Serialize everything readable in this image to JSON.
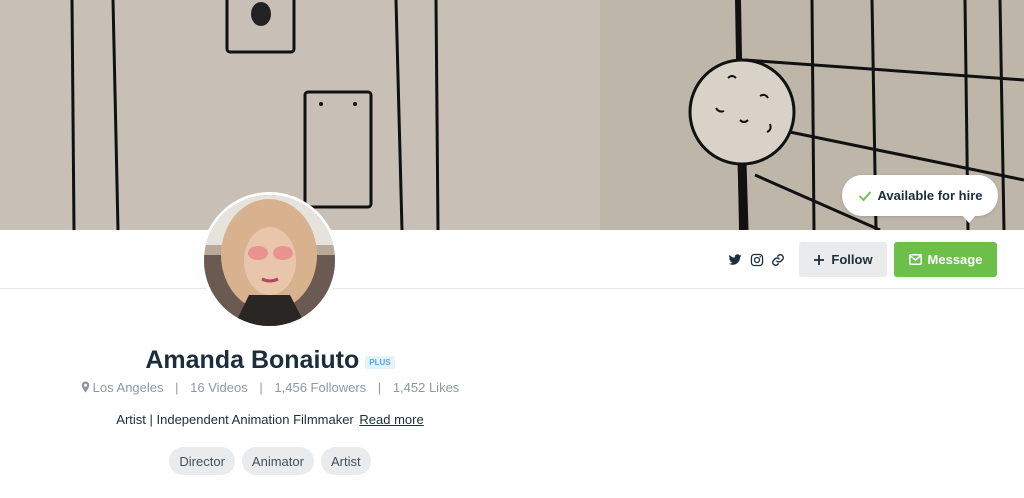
{
  "cover": {
    "alt": "drawn doorway illustration"
  },
  "hire": {
    "label": "Available for hire"
  },
  "social": {
    "icons": [
      "twitter-icon",
      "instagram-icon",
      "link-icon"
    ]
  },
  "actions": {
    "follow_label": "Follow",
    "message_label": "Message"
  },
  "profile": {
    "name": "Amanda Bonaiuto",
    "badge": "PLUS",
    "location": "Los Angeles",
    "videos": "16 Videos",
    "followers": "1,456 Followers",
    "likes": "1,452 Likes",
    "bio": "Artist | Independent Animation Filmmaker",
    "read_more": "Read more",
    "tags": [
      "Director",
      "Animator",
      "Artist"
    ]
  },
  "colors": {
    "accent_green": "#6cc04a",
    "text_dark": "#1a2e3b",
    "text_muted": "#8c99a4",
    "badge_blue": "#5aa9db"
  }
}
